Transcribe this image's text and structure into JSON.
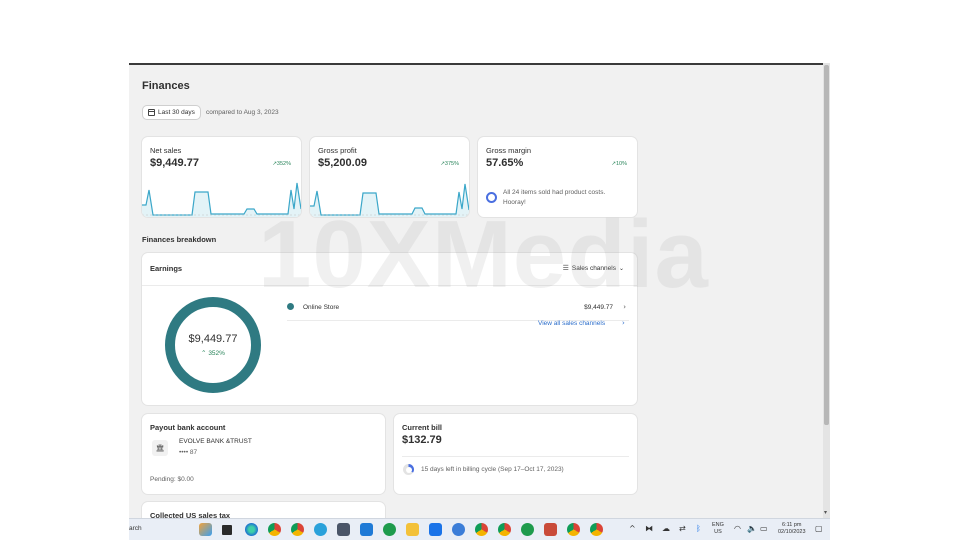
{
  "page": {
    "title": "Finances",
    "date_button": "Last 30 days",
    "compared": "compared to Aug 3, 2023"
  },
  "metrics": [
    {
      "label": "Net sales",
      "value": "$9,449.77",
      "change": "352%"
    },
    {
      "label": "Gross profit",
      "value": "$5,200.09",
      "change": "375%"
    },
    {
      "label": "Gross margin",
      "value": "57.65%",
      "change": "10%",
      "note": "All 24 items sold had product costs. Hooray!"
    }
  ],
  "breakdown": {
    "section_title": "Finances breakdown",
    "earnings_title": "Earnings",
    "channels_button": "Sales channels",
    "total": "$9,449.77",
    "total_change": "352%",
    "rows": [
      {
        "name": "Online Store",
        "value": "$9,449.77"
      }
    ],
    "view_all": "View all sales channels"
  },
  "payout": {
    "title": "Payout bank account",
    "bank": "EVOLVE BANK &TRUST",
    "account": "•••• 87",
    "pending": "Pending: $0.00"
  },
  "bill": {
    "title": "Current bill",
    "value": "$132.79",
    "cycle": "15 days left in billing cycle (Sep 17–Oct 17, 2023)"
  },
  "tax": {
    "title": "Collected US sales tax"
  },
  "taskbar": {
    "search": "arch",
    "lang_top": "ENG",
    "lang_bottom": "US",
    "time": "6:11 pm",
    "date": "02/10/2023"
  },
  "watermark": "10XMedia",
  "colors": {
    "accent": "#2f7a82",
    "positive": "#29845a",
    "link": "#2c6ecb"
  }
}
